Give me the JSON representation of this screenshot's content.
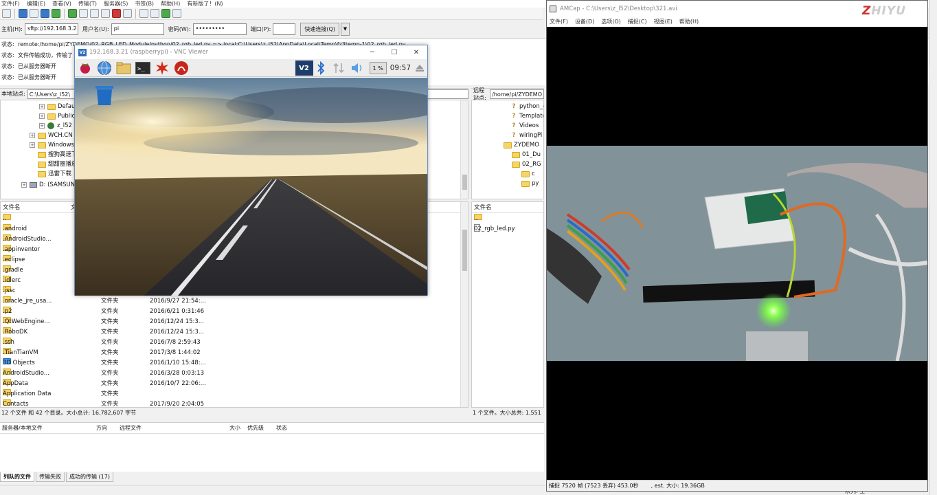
{
  "filezilla": {
    "menu": [
      "文件(F)",
      "编辑(E)",
      "查看(V)",
      "传输(T)",
      "服务器(S)",
      "书签(B)",
      "帮助(H)",
      "有新版了！(N)"
    ],
    "quickconnect": {
      "host_label": "主机(H):",
      "host_value": "sftp://192.168.3.2",
      "user_label": "用户名(U):",
      "user_value": "pi",
      "pass_label": "密码(W):",
      "pass_value": "•••••••••",
      "port_label": "端口(P):",
      "port_value": "",
      "connect_label": "快速连接(Q)"
    },
    "log": [
      {
        "tag": "状态:",
        "msg": "remote:/home/pi/ZYDEMO/02_RGB_LED_Module/python/02_rgb_led.py => local:C:\\Users\\z_l52\\AppData\\Local\\Temp\\fz3temp-1\\02_rgb_led.py"
      },
      {
        "tag": "状态:",
        "msg": "文件传输成功，传输了"
      },
      {
        "tag": "状态:",
        "msg": "已从服务器断开"
      },
      {
        "tag": "状态:",
        "msg": "已从服务器断开"
      }
    ],
    "local_site_label": "本地站点:",
    "local_site_path": "C:\\Users\\z_l52\\",
    "remote_site_label": "远程站点:",
    "remote_site_path": "/home/pi/ZYDEMO",
    "local_tree": [
      {
        "label": "Defau",
        "kind": "folder",
        "exp": "+"
      },
      {
        "label": "Public",
        "kind": "folder",
        "exp": "+"
      },
      {
        "label": "z_l52",
        "kind": "user",
        "exp": "+"
      },
      {
        "label": "WCH.CN",
        "kind": "folder",
        "exp": "+"
      },
      {
        "label": "Windows",
        "kind": "folder",
        "exp": "+"
      },
      {
        "label": "搜狗高速下",
        "kind": "folder",
        "exp": ""
      },
      {
        "label": "甜甜圈播放",
        "kind": "folder",
        "exp": ""
      },
      {
        "label": "迅雷下载",
        "kind": "folder",
        "exp": ""
      },
      {
        "label": "D: (SAMSUN",
        "kind": "drive",
        "exp": "+"
      }
    ],
    "remote_tree": [
      {
        "label": "python_g",
        "kind": "q"
      },
      {
        "label": "Template",
        "kind": "q"
      },
      {
        "label": "Videos",
        "kind": "q"
      },
      {
        "label": "wiringPi",
        "kind": "q"
      },
      {
        "label": "ZYDEMO",
        "kind": "folder"
      },
      {
        "label": "01_Du",
        "kind": "folder"
      },
      {
        "label": "02_RG",
        "kind": "folder"
      },
      {
        "label": "c",
        "kind": "folder"
      },
      {
        "label": "py",
        "kind": "folder"
      }
    ],
    "local_list_header": {
      "name": "文件名",
      "size": "文"
    },
    "local_files": [
      {
        "name": "..",
        "type": "",
        "date": ""
      },
      {
        "name": ".android",
        "type": "",
        "date": ""
      },
      {
        "name": ".AndroidStudio...",
        "type": "",
        "date": ""
      },
      {
        "name": ".appinventor",
        "type": "",
        "date": ""
      },
      {
        "name": ".eclipse",
        "type": "",
        "date": ""
      },
      {
        "name": ".gradle",
        "type": "",
        "date": ""
      },
      {
        "name": ".idlerc",
        "type": "",
        "date": ""
      },
      {
        "name": ".jssc",
        "type": "",
        "date": ""
      },
      {
        "name": ".oracle_jre_usa...",
        "type": "文件夹",
        "date": "2016/9/27 21:54:..."
      },
      {
        "name": ".p2",
        "type": "文件夹",
        "date": "2016/6/21 0:31:46"
      },
      {
        "name": ".QtWebEngine...",
        "type": "文件夹",
        "date": "2016/12/24 15:3..."
      },
      {
        "name": ".RoboDK",
        "type": "文件夹",
        "date": "2016/12/24 15:3..."
      },
      {
        "name": ".ssh",
        "type": "文件夹",
        "date": "2016/7/8 2:59:43"
      },
      {
        "name": ".TianTianVM",
        "type": "文件夹",
        "date": "2017/3/8 1:44:02"
      },
      {
        "name": "3D Objects",
        "type": "文件夹",
        "date": "2016/1/10 15:48:..."
      },
      {
        "name": "AndroidStudio...",
        "type": "文件夹",
        "date": "2016/3/28 0:03:13"
      },
      {
        "name": "AppData",
        "type": "文件夹",
        "date": "2016/10/7 22:06:..."
      },
      {
        "name": "Application Data",
        "type": "文件夹",
        "date": ""
      },
      {
        "name": "Contacts",
        "type": "文件夹",
        "date": "2017/9/20 2:04:05"
      }
    ],
    "remote_list_header": {
      "name": "文件名"
    },
    "remote_files": [
      {
        "name": ".."
      },
      {
        "name": "02_rgb_led.py"
      }
    ],
    "local_status": "12 个文件 和 42 个目录。大小总计: 16,782,607 字节",
    "remote_status": "1 个文件。大小总共: 1,551",
    "queue_headers": [
      "服务器/本地文件",
      "方向",
      "远程文件",
      "大小",
      "优先级",
      "状态"
    ],
    "queue_tabs": [
      "列队的文件",
      "传输失败",
      "成功的传输 (17)"
    ],
    "queue_status": "队列: 空"
  },
  "vnc": {
    "badge": "V2",
    "title": "192.168.3.21 (raspberrypi) - VNC Viewer",
    "cpu": "1 %",
    "time": "09:57"
  },
  "amcap": {
    "title": "AMCap - C:\\Users\\z_l52\\Desktop\\321.avi",
    "menu": [
      "文件(F)",
      "设备(D)",
      "选项(O)",
      "捕捉(C)",
      "视图(E)",
      "帮助(H)"
    ],
    "status_capture": "捕捉 7520 帧 (7523 丢弃) 453.0秒",
    "status_size": ", est. 大小: 19.36GB"
  },
  "logo": {
    "a": "Z",
    "b": "HIYU"
  }
}
